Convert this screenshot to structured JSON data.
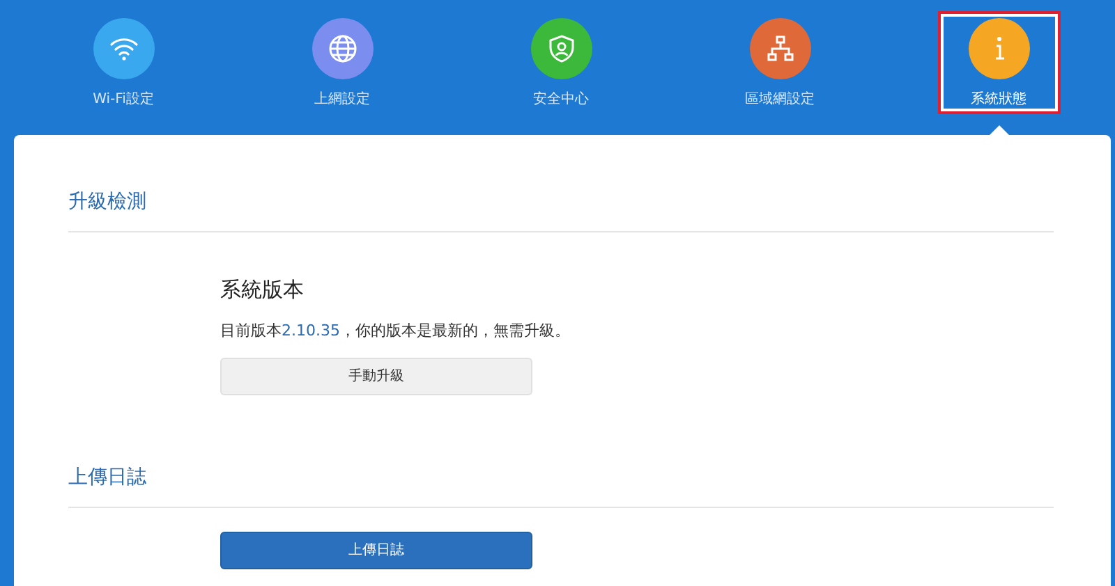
{
  "nav": [
    {
      "label": "Wi-Fi設定",
      "kind": "wifi",
      "color": "#3aa8ee",
      "selected": false
    },
    {
      "label": "上網設定",
      "kind": "globe",
      "color": "#7b8ef0",
      "selected": false
    },
    {
      "label": "安全中心",
      "kind": "shield",
      "color": "#3cb83a",
      "selected": false
    },
    {
      "label": "區域網設定",
      "kind": "network",
      "color": "#e0693a",
      "selected": false
    },
    {
      "label": "系統狀態",
      "kind": "info",
      "color": "#f5a623",
      "selected": true
    }
  ],
  "sections": [
    {
      "title": "升級檢測",
      "subtitle": "系統版本",
      "status": {
        "before": "目前版本",
        "version": "2.10.35",
        "after": "，你的版本是最新的，無需升級。"
      },
      "button": {
        "label": "手動升級",
        "kind": "secondary"
      }
    },
    {
      "title": "上傳日誌",
      "button": {
        "label": "上傳日誌",
        "kind": "primary"
      }
    }
  ]
}
